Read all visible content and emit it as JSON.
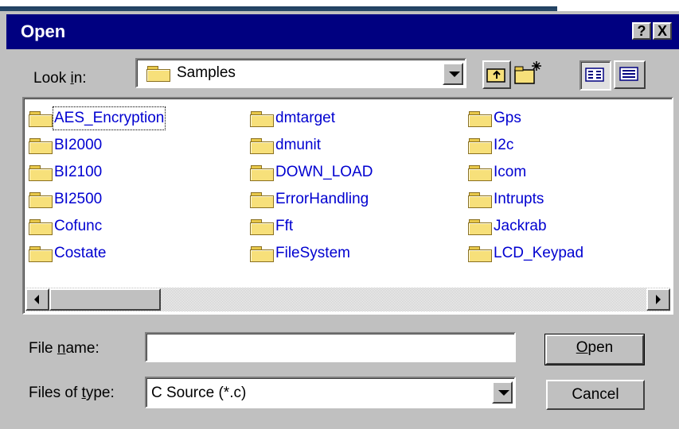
{
  "window": {
    "title": "Open",
    "help_label": "?",
    "close_label": "X"
  },
  "look_in": {
    "label_pre": "Look ",
    "label_key": "i",
    "label_post": "n:",
    "value": "Samples"
  },
  "toolbar_icons": [
    "up-one-level-icon",
    "create-new-folder-icon",
    "list-view-icon",
    "details-view-icon"
  ],
  "files": {
    "col1": [
      "AES_Encryption",
      "BI2000",
      "BI2100",
      "BI2500",
      "Cofunc",
      "Costate"
    ],
    "col2": [
      "dmtarget",
      "dmunit",
      "DOWN_LOAD",
      "ErrorHandling",
      "Fft",
      "FileSystem"
    ],
    "col3": [
      "Gps",
      "I2c",
      "Icom",
      "Intrupts",
      "Jackrab",
      "LCD_Keypad"
    ]
  },
  "file_name": {
    "label_pre": "File ",
    "label_key": "n",
    "label_post": "ame:",
    "value": ""
  },
  "file_type": {
    "label_pre": "Files of ",
    "label_key": "t",
    "label_post": "ype:",
    "value": "C Source (*.c)"
  },
  "buttons": {
    "open_key": "O",
    "open_rest": "pen",
    "cancel": "Cancel"
  },
  "colors": {
    "titlebar": "#000080",
    "face": "#c0c0c0",
    "link": "#0000d0"
  }
}
